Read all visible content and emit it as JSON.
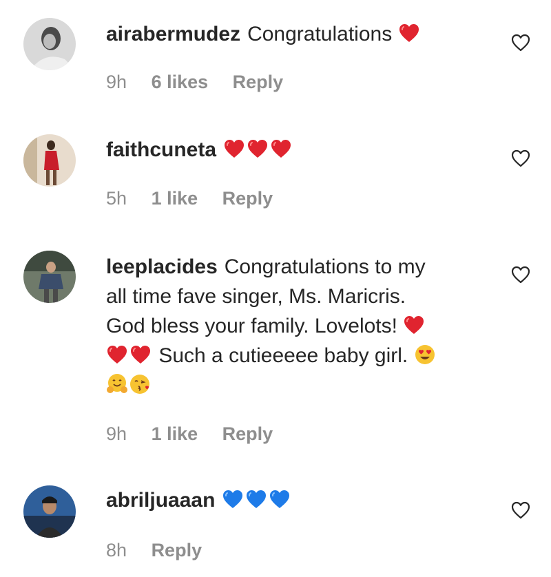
{
  "comments": [
    {
      "username": "airabermudez",
      "text": "Congratulations",
      "time": "9h",
      "likes": "6 likes",
      "reply": "Reply"
    },
    {
      "username": "faithcuneta",
      "text": "",
      "time": "5h",
      "likes": "1 like",
      "reply": "Reply"
    },
    {
      "username": "leeplacides",
      "text_line1": "Congratulations to my",
      "text_line2": "all time fave singer, Ms. Maricris.",
      "text_line3": "God bless your family. Lovelots!",
      "text_line4": "Such a cutieeeee baby girl.",
      "time": "9h",
      "likes": "1 like",
      "reply": "Reply"
    },
    {
      "username": "abriljuaaan",
      "text": "",
      "time": "8h",
      "reply": "Reply"
    }
  ],
  "colors": {
    "text": "#262626",
    "meta": "#8e8e8e",
    "red_heart": "#e0242f",
    "blue_heart": "#1e7be8"
  },
  "icons": [
    "heart-outline-icon",
    "red-heart-emoji",
    "blue-heart-emoji",
    "heart-eyes-emoji",
    "hugging-emoji",
    "kissing-emoji"
  ]
}
